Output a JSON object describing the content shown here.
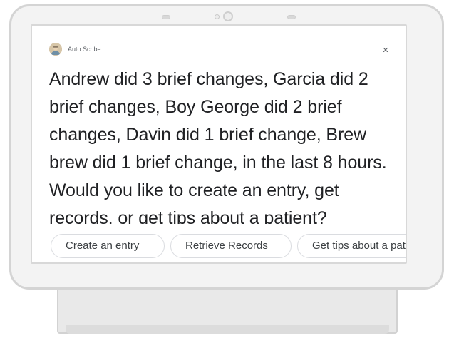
{
  "assistant": {
    "app_name": "Auto Scribe",
    "avatar_icon": "assistant-avatar-icon",
    "close_icon": "close-icon",
    "message": "Andrew did 3 brief changes, Garcia did 2 brief changes, Boy George did 2 brief changes, Davin did 1 brief change, Brew brew did 1 brief change, in the last 8 hours. Would you like to create an entry, get records, or get tips about a patient?"
  },
  "suggestions": [
    {
      "label": "Create an entry"
    },
    {
      "label": "Retrieve Records"
    },
    {
      "label": "Get tips about a patient"
    }
  ],
  "colors": {
    "text": "#202124",
    "chip_border": "#dadce0",
    "frame": "#d4d4d4"
  }
}
